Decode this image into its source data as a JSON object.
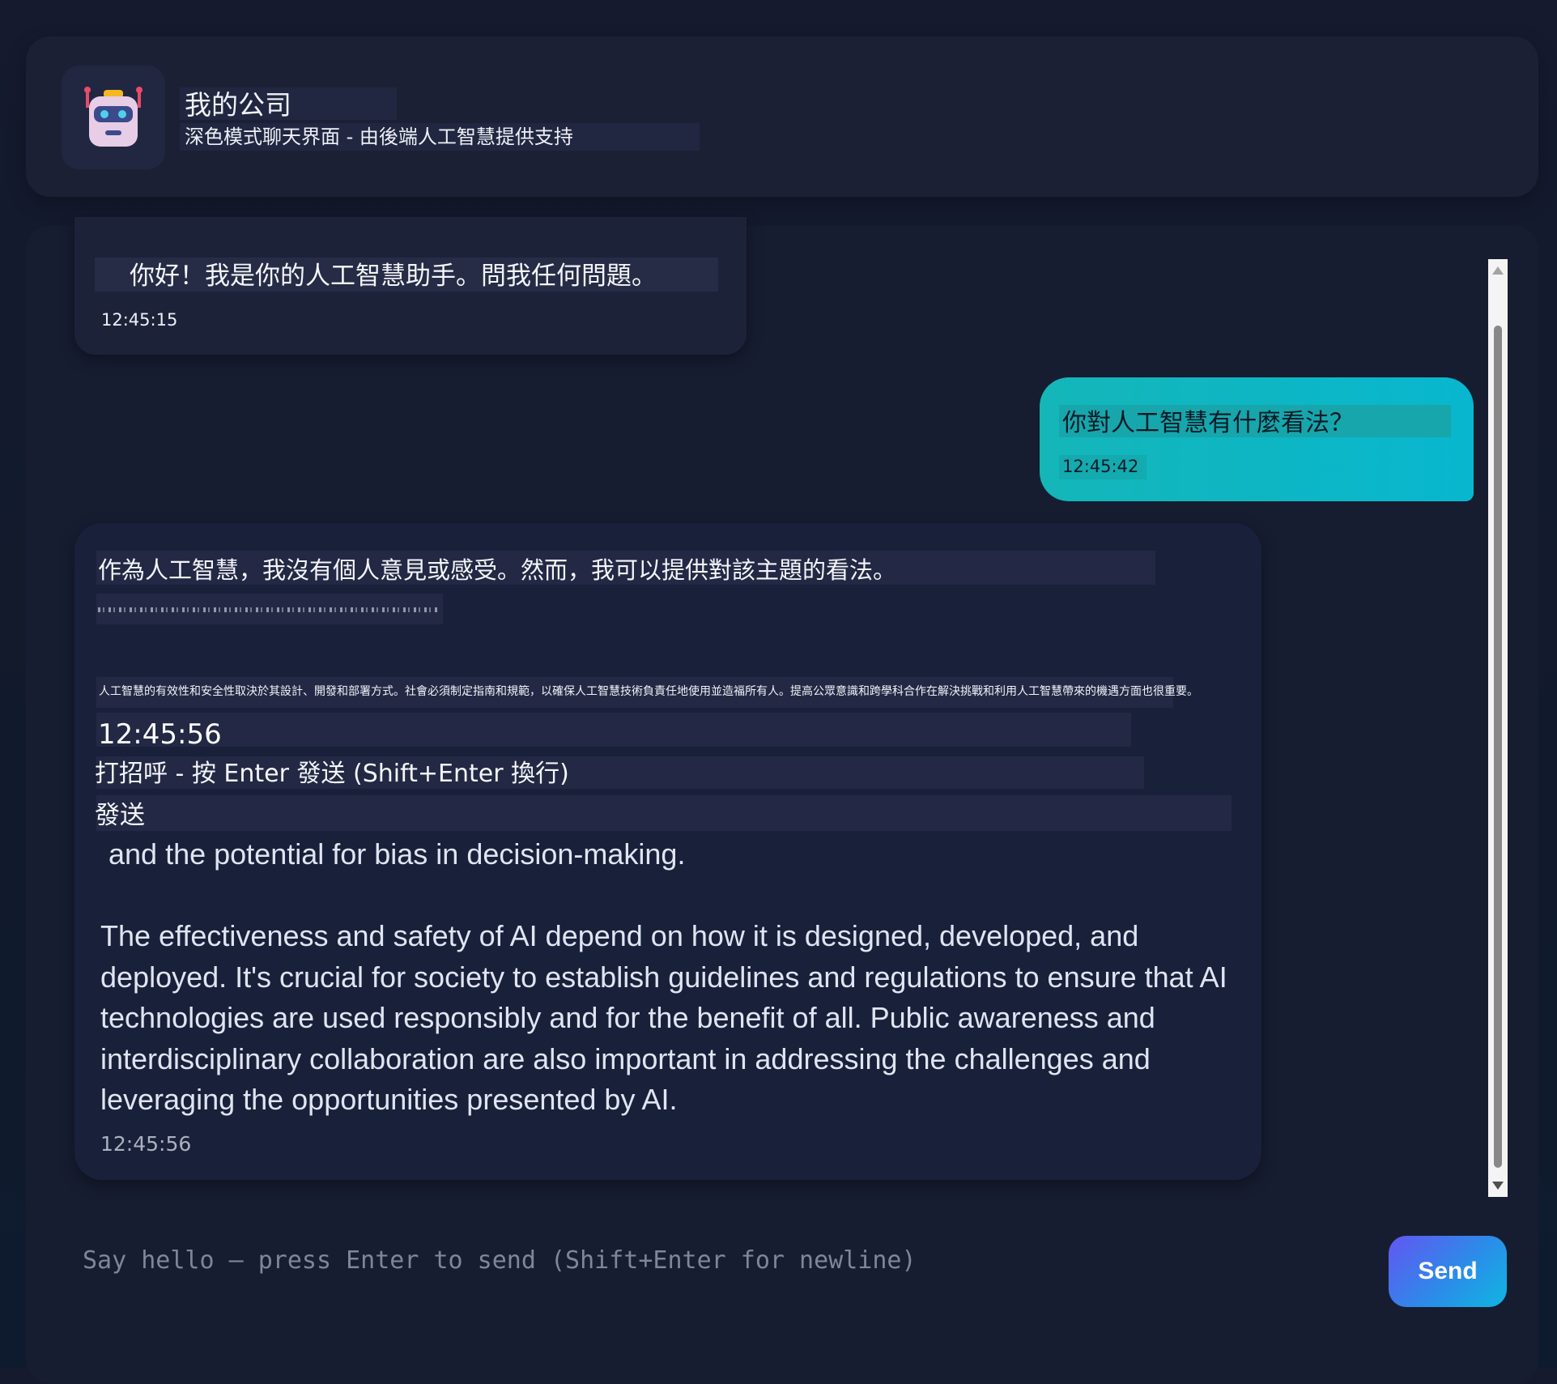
{
  "header": {
    "avatar_icon": "robot-icon",
    "title": "我的公司",
    "subtitle": "深色模式聊天界面 - 由後端人工智慧提供支持"
  },
  "messages": [
    {
      "role": "assistant",
      "text": "你好！我是你的人工智慧助手。問我任何問題。",
      "time": "12:45:15"
    },
    {
      "role": "user",
      "text": "你對人工智慧有什麼看法？",
      "time": "12:45:42"
    },
    {
      "role": "assistant",
      "intro": "作為人工智慧，我沒有個人意見或感受。然而，我可以提供對該主題的看法。",
      "zh_paragraph": "人工智慧的有效性和安全性取決於其設計、開發和部署方式。社會必須制定指南和規範，以確保人工智慧技術負責任地使用並造福所有人。提高公眾意識和跨學科合作在解決挑戰和利用人工智慧帶來的機遇方面也很重要。",
      "overlay_time": "12:45:56",
      "overlay_hint": "打招呼 - 按 Enter 發送 (Shift+Enter 換行)",
      "overlay_send": "發送",
      "english_text": " and the potential for bias in decision-making.\n\nThe effectiveness and safety of AI depend on how it is designed, developed, and deployed. It's crucial for society to establish guidelines and regulations to ensure that AI technologies are used responsibly and for the benefit of all. Public awareness and interdisciplinary collaboration are also important in addressing the challenges and leveraging the opportunities presented by AI.",
      "time": "12:45:56"
    }
  ],
  "composer": {
    "placeholder": "Say hello — press Enter to send (Shift+Enter for newline)",
    "value": "",
    "send_label": "Send"
  },
  "colors": {
    "background": "#151a2e",
    "user_bubble": "#08b7cf",
    "send_gradient_start": "#6356f2",
    "send_gradient_end": "#0fb6e1"
  }
}
